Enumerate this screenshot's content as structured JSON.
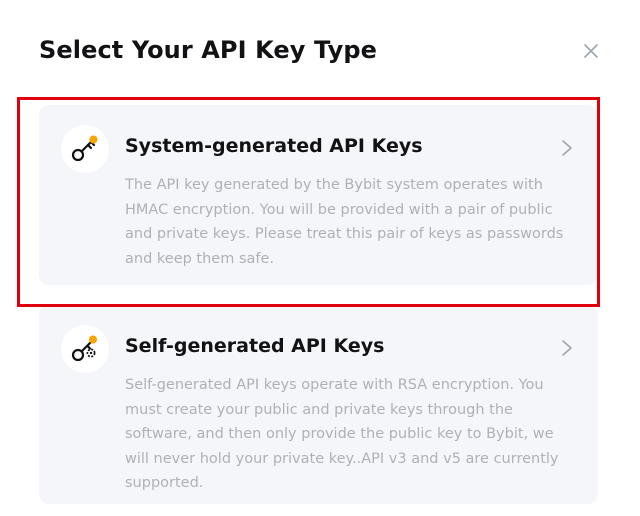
{
  "modal": {
    "title": "Select Your API Key Type",
    "close_icon": "close-icon"
  },
  "options": [
    {
      "title": "System-generated API Keys",
      "description": "The API key generated by the Bybit system operates with HMAC encryption. You will be provided with a pair of public and private keys. Please treat this pair of keys as passwords and keep them safe.",
      "icon": "key-icon",
      "highlighted": true
    },
    {
      "title": "Self-generated API Keys",
      "description": "Self-generated API keys operate with RSA encryption. You must create your public and private keys through the software, and then only provide the public key to Bybit, we will never hold your private key..API v3 and v5 are currently supported.",
      "icon": "key-gear-icon",
      "highlighted": false
    }
  ],
  "colors": {
    "highlight": "#e0000d",
    "card_background": "#f5f6f9",
    "icon_accent": "#f7a600",
    "description_text": "#adb1b8"
  }
}
